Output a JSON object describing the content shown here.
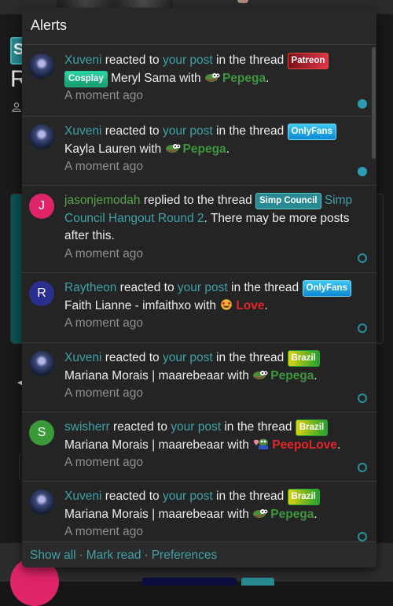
{
  "background": {
    "node_badge": "S",
    "title_initial": "R"
  },
  "popup": {
    "title": "Alerts",
    "alerts": [
      {
        "user": "Xuveni",
        "action": "reacted to",
        "post_link": "your post",
        "in_thread": "in the thread",
        "tag": "Patreon",
        "tag2": "Cosplay",
        "thread": "Meryl Sama",
        "with": "with",
        "reaction": "Pepega",
        "time": "A moment ago",
        "unread": true
      },
      {
        "user": "Xuveni",
        "action": "reacted to",
        "post_link": "your post",
        "in_thread": "in the thread",
        "tag": "OnlyFans",
        "thread": "Kayla Lauren",
        "with": "with",
        "reaction": "Pepega",
        "time": "A moment ago",
        "unread": true
      },
      {
        "user": "jasonjemodah",
        "avatar_letter": "J",
        "action": "replied to the thread",
        "tag": "Simp Council",
        "thread_link": "Simp Council Hangout Round 2",
        "suffix": ". There may be more posts after this.",
        "time": "A moment ago",
        "unread": false
      },
      {
        "user": "Raytheon",
        "avatar_letter": "R",
        "action": "reacted to",
        "post_link": "your post",
        "in_thread": "in the thread",
        "tag": "OnlyFans",
        "thread": "Faith Lianne - imfaithxo",
        "with": "with",
        "reaction": "Love",
        "time": "A moment ago",
        "unread": false
      },
      {
        "user": "Xuveni",
        "action": "reacted to",
        "post_link": "your post",
        "in_thread": "in the thread",
        "tag": "Brazil",
        "thread": "Mariana Morais | maarebeaar",
        "with": "with",
        "reaction": "Pepega",
        "time": "A moment ago",
        "unread": false
      },
      {
        "user": "swisherr",
        "avatar_letter": "S",
        "action": "reacted to",
        "post_link": "your post",
        "in_thread": "in the thread",
        "tag": "Brazil",
        "thread": "Mariana Morais | maarebeaar",
        "with": "with",
        "reaction": "PeepoLove",
        "time": "A moment ago",
        "unread": false
      },
      {
        "user": "Xuveni",
        "action": "reacted to",
        "post_link": "your post",
        "in_thread": "in the thread",
        "tag": "Brazil",
        "thread": "Mariana Morais | maarebeaar",
        "with": "with",
        "reaction": "Pepega",
        "time": "A moment ago",
        "unread": false
      }
    ],
    "footer": {
      "show_all": "Show all",
      "mark_read": "Mark read",
      "preferences": "Preferences",
      "separator": "·"
    }
  },
  "colors": {
    "link": "#3fa2a8",
    "unread_dot": "#2a9db3",
    "pepega": "#3e963f",
    "love": "#e0262b"
  }
}
